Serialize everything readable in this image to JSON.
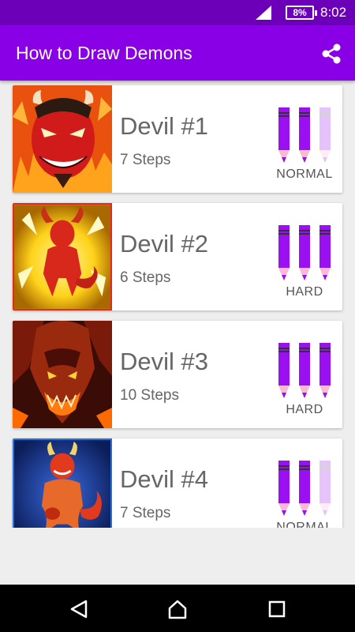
{
  "status_bar": {
    "battery": "8%",
    "time": "8:02",
    "icons": [
      "signal-icon",
      "battery-icon"
    ]
  },
  "app_bar": {
    "title": "How to Draw Demons",
    "share_icon": "share-icon"
  },
  "colors": {
    "status_bar": "#6c00b8",
    "app_bar": "#8a00e6",
    "pencil_active": "#9b10f0",
    "pencil_inactive": "#e7d8f5"
  },
  "items": [
    {
      "title": "Devil #1",
      "steps": "7 Steps",
      "difficulty": "NORMAL",
      "difficulty_level": 2,
      "difficulty_max": 3
    },
    {
      "title": "Devil #2",
      "steps": "6 Steps",
      "difficulty": "HARD",
      "difficulty_level": 3,
      "difficulty_max": 3
    },
    {
      "title": "Devil #3",
      "steps": "10 Steps",
      "difficulty": "HARD",
      "difficulty_level": 3,
      "difficulty_max": 3
    },
    {
      "title": "Devil #4",
      "steps": "7 Steps",
      "difficulty": "NORMAL",
      "difficulty_level": 2,
      "difficulty_max": 3
    }
  ],
  "nav_bar": {
    "icons": [
      "back-icon",
      "home-icon",
      "recents-icon"
    ]
  }
}
